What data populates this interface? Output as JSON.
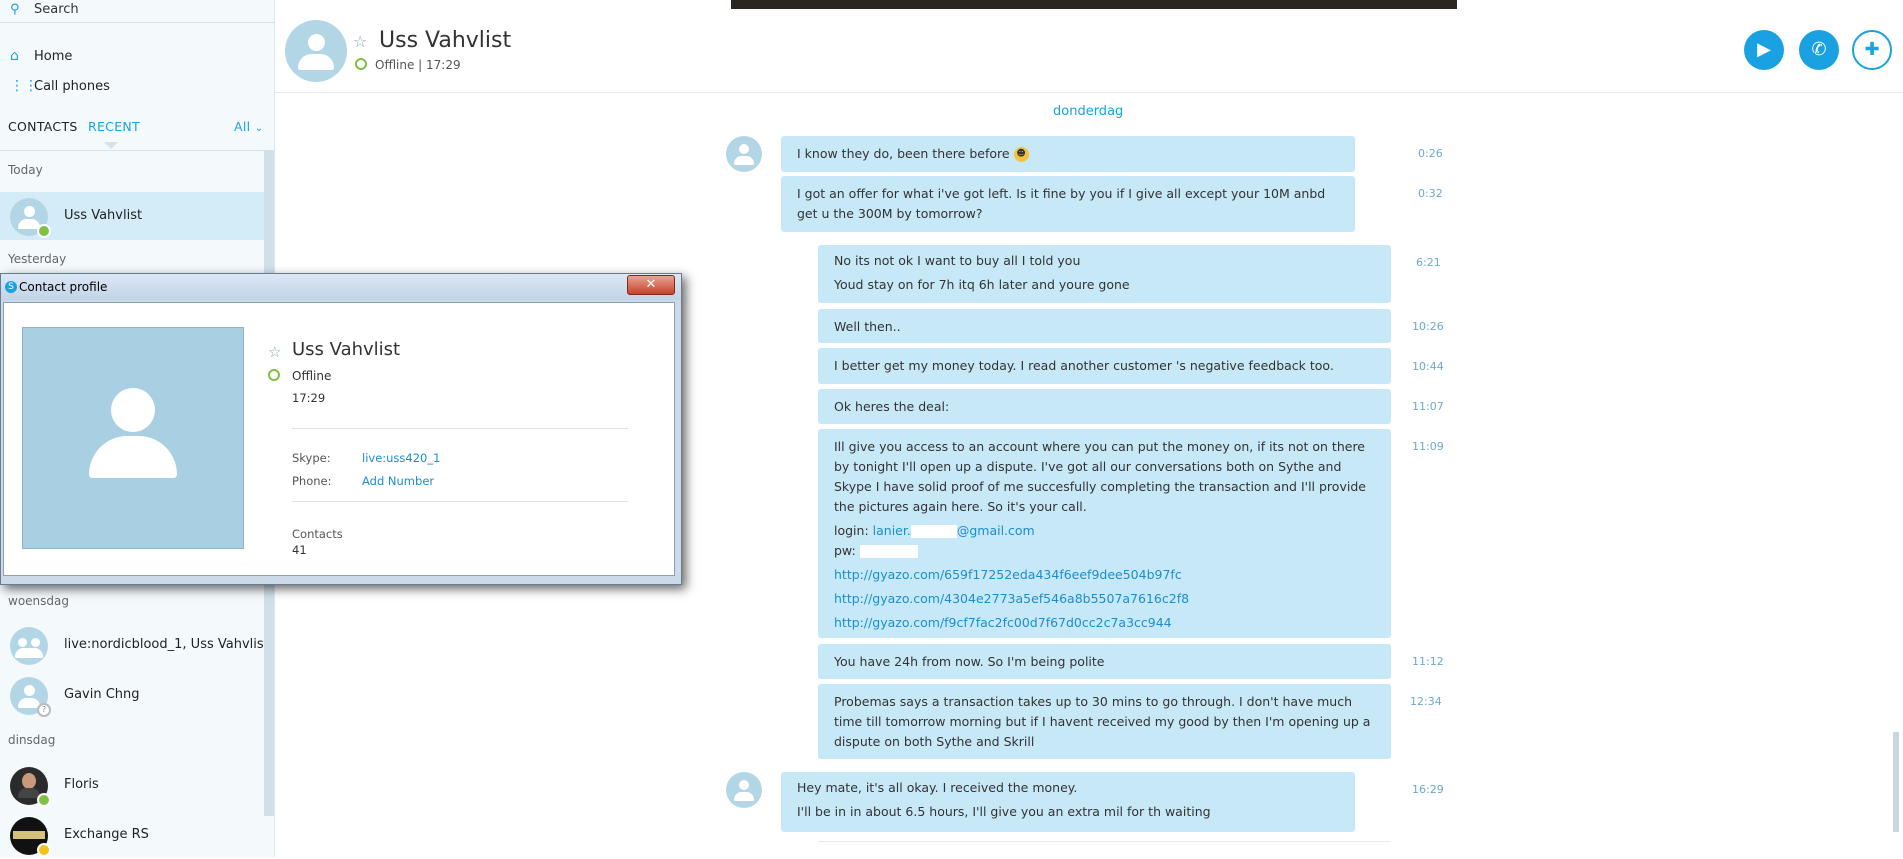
{
  "sidebar": {
    "search_label": "Search",
    "nav": [
      {
        "label": "Home"
      },
      {
        "label": "Call phones"
      }
    ],
    "tabs": {
      "contacts": "CONTACTS",
      "recent": "RECENT",
      "filter": "All"
    },
    "sections": {
      "today": "Today",
      "yesterday": "Yesterday",
      "wednesday": "woensdag",
      "tuesday": "dinsdag"
    },
    "contacts": [
      {
        "name": "Uss Vahvlist",
        "status": "online",
        "status_color": "#7fc243"
      },
      {
        "name": "live:nordicblood_1, Uss Vahvlist",
        "status": "group"
      },
      {
        "name": "Gavin Chng",
        "status": "unknown"
      },
      {
        "name": "Floris",
        "status": "online",
        "status_color": "#7fc243"
      },
      {
        "name": "Exchange RS",
        "status": "away",
        "status_color": "#f3c21b"
      }
    ]
  },
  "header": {
    "contact_name": "Uss Vahvlist",
    "status_line": "Offline | 17:29",
    "buttons": {
      "video": "video-call",
      "call": "audio-call",
      "add": "add-people"
    }
  },
  "chat": {
    "day_label": "donderdag",
    "messages": [
      {
        "dir": "out",
        "lines": [
          "I know they do, been there before"
        ],
        "time": "0:26",
        "emoji": true
      },
      {
        "dir": "out",
        "lines": [
          "I got an offer for what i've got left. Is it fine by you if I give all except your 10M anbd get u the 300M by tomorrow?"
        ],
        "time": "0:32"
      },
      {
        "dir": "in",
        "lines": [
          "No its not ok I want to buy all I told you",
          "Youd stay on for 7h itq 6h later and youre gone"
        ],
        "time": "6:21"
      },
      {
        "dir": "in",
        "lines": [
          "Well then.."
        ],
        "time": "10:26"
      },
      {
        "dir": "in",
        "lines": [
          "I better get my money today. I read another customer 's negative feedback too."
        ],
        "time": "10:44"
      },
      {
        "dir": "in",
        "lines": [
          "Ok heres the deal:"
        ],
        "time": "11:07"
      },
      {
        "dir": "in",
        "text": "Ill give you access to an account where you can put the money on, if its not on there by tonight I'll open up a dispute. I've got all our conversations both on Sythe and Skype I have solid proof of me succesfully completing the transaction and I'll provide the pictures again here. So it's your call.",
        "login_label": "login: ",
        "login_user": "lanier.",
        "login_domain": "@gmail.com",
        "pw_label": "pw: ",
        "links": [
          "http://gyazo.com/659f17252eda434f6eef9dee504b97fc",
          "http://gyazo.com/4304e2773a5ef546a8b5507a7616c2f8",
          "http://gyazo.com/f9cf7fac2fc00d7f67d0cc2c7a3cc944"
        ],
        "time": "11:09"
      },
      {
        "dir": "in",
        "lines": [
          "You have 24h from now. So I'm being polite"
        ],
        "time": "11:12"
      },
      {
        "dir": "in",
        "lines": [
          "Probemas says a transaction takes up to 30 mins to go through. I don't have much time till tomorrow morning but if I havent received my good by then I'm opening up a dispute on both Sythe and Skrill"
        ],
        "time": "12:34"
      },
      {
        "dir": "out",
        "lines": [
          "Hey mate, it's all okay. I received the money.",
          "I'll be in in about 6.5 hours, I'll give you an extra mil for th waiting"
        ],
        "time": "16:29"
      }
    ]
  },
  "dialog": {
    "title": "Contact profile",
    "close_glyph": "✕",
    "name": "Uss Vahvlist",
    "status": "Offline",
    "local_time": "17:29",
    "skype_label": "Skype:",
    "skype_value": "live:uss420_1",
    "phone_label": "Phone:",
    "phone_value": "Add Number",
    "contacts_label": "Contacts",
    "contacts_count": "41"
  },
  "colors": {
    "accent": "#1aa1e1",
    "bubble": "#c7e8f7",
    "online": "#7fc243",
    "away": "#f3c21b"
  }
}
